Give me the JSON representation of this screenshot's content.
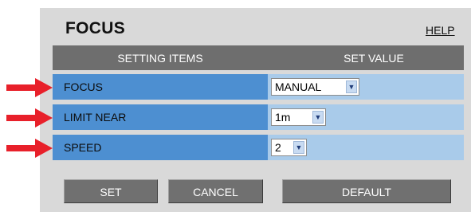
{
  "page": {
    "title": "FOCUS",
    "help_link": "HELP"
  },
  "table": {
    "headers": [
      "SETTING ITEMS",
      "SET VALUE"
    ],
    "rows": [
      {
        "label": "FOCUS",
        "value": "MANUAL"
      },
      {
        "label": "LIMIT NEAR",
        "value": "1m"
      },
      {
        "label": "SPEED",
        "value": "2"
      }
    ]
  },
  "buttons": {
    "set": "SET",
    "cancel": "CANCEL",
    "default": "DEFAULT"
  },
  "colors": {
    "panel_bg": "#d9d9d9",
    "header_bg": "#6e6e6e",
    "label_cell_bg": "#4d8fd1",
    "value_cell_bg": "#a9cbea",
    "button_bg": "#707070",
    "annotation_arrow": "#e8202a"
  },
  "icons": {
    "annotation": "red-arrow-icon",
    "dropdown": "chevron-down-icon"
  }
}
